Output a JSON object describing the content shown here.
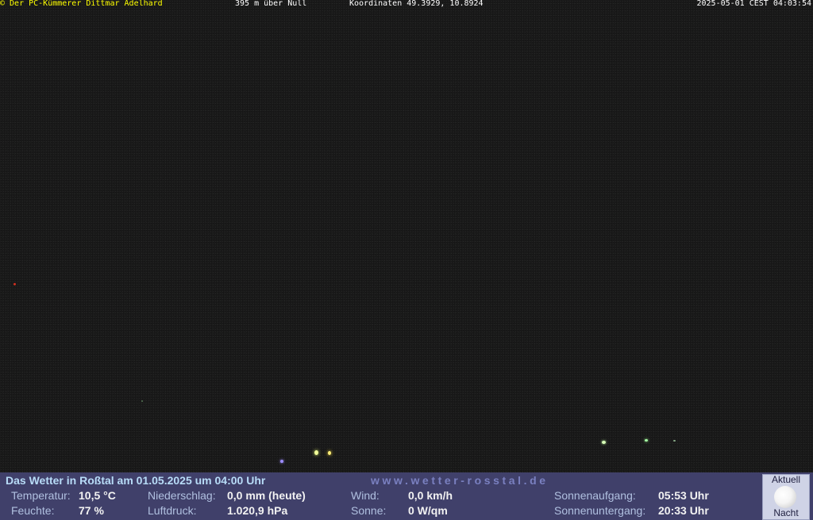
{
  "overlay": {
    "owner": "© Der PC-Kümmerer Dittmar Adelhard",
    "altitude": "395 m über Null",
    "coordinates": "Koordinaten 49.3929, 10.8924",
    "timestamp": "2025-05-01 CEST 04:03:54"
  },
  "weather": {
    "headline": "Das Wetter in Roßtal am 01.05.2025 um 04:00 Uhr",
    "website": "www.wetter-rosstal.de",
    "temperature_label": "Temperatur:",
    "temperature_value": "10,5 °C",
    "humidity_label": "Feuchte:",
    "humidity_value": "77 %",
    "precip_label": "Niederschlag:",
    "precip_value": "0,0 mm (heute)",
    "pressure_label": "Luftdruck:",
    "pressure_value": "1.020,9 hPa",
    "wind_label": "Wind:",
    "wind_value": "0,0 km/h",
    "sun_label": "Sonne:",
    "sun_value": "0 W/qm",
    "sunrise_label": "Sonnenaufgang:",
    "sunrise_value": "05:53 Uhr",
    "sunset_label": "Sonnenuntergang:",
    "sunset_value": "20:33 Uhr"
  },
  "moon": {
    "top_label": "Aktuell",
    "bottom_label": "Nacht",
    "icon": "full-moon-icon"
  },
  "colors": {
    "overlay_owner": "#ffff00",
    "panel_background": "#40406a",
    "headline": "#b8dcf8"
  }
}
